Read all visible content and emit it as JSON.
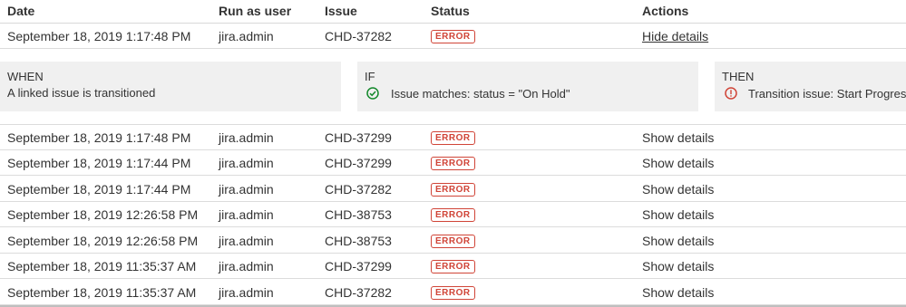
{
  "table": {
    "headers": {
      "date": "Date",
      "user": "Run as user",
      "issue": "Issue",
      "status": "Status",
      "actions": "Actions"
    },
    "expanded_row": {
      "date": "September 18, 2019 1:17:48 PM",
      "user": "jira.admin",
      "issue": "CHD-37282",
      "status": "ERROR",
      "action": "Hide details"
    },
    "details": {
      "when_title": "WHEN",
      "when_body": "A linked issue is transitioned",
      "if_title": "IF",
      "if_body": "Issue matches: status = \"On Hold\"",
      "then_title": "THEN",
      "then_body": "Transition issue: Start Progress",
      "if_icon": "check-circle-icon",
      "then_icon": "error-circle-icon"
    },
    "rows": [
      {
        "date": "September 18, 2019 1:17:48 PM",
        "user": "jira.admin",
        "issue": "CHD-37299",
        "status": "ERROR",
        "action": "Show details"
      },
      {
        "date": "September 18, 2019 1:17:44 PM",
        "user": "jira.admin",
        "issue": "CHD-37299",
        "status": "ERROR",
        "action": "Show details"
      },
      {
        "date": "September 18, 2019 1:17:44 PM",
        "user": "jira.admin",
        "issue": "CHD-37282",
        "status": "ERROR",
        "action": "Show details"
      },
      {
        "date": "September 18, 2019 12:26:58 PM",
        "user": "jira.admin",
        "issue": "CHD-38753",
        "status": "ERROR",
        "action": "Show details"
      },
      {
        "date": "September 18, 2019 12:26:58 PM",
        "user": "jira.admin",
        "issue": "CHD-38753",
        "status": "ERROR",
        "action": "Show details"
      },
      {
        "date": "September 18, 2019 11:35:37 AM",
        "user": "jira.admin",
        "issue": "CHD-37299",
        "status": "ERROR",
        "action": "Show details"
      },
      {
        "date": "September 18, 2019 11:35:37 AM",
        "user": "jira.admin",
        "issue": "CHD-37282",
        "status": "ERROR",
        "action": "Show details"
      }
    ]
  },
  "colors": {
    "error": "#d04437",
    "success": "#14892c",
    "link": "#3572b0",
    "panel_bg": "#f0f0f0"
  }
}
